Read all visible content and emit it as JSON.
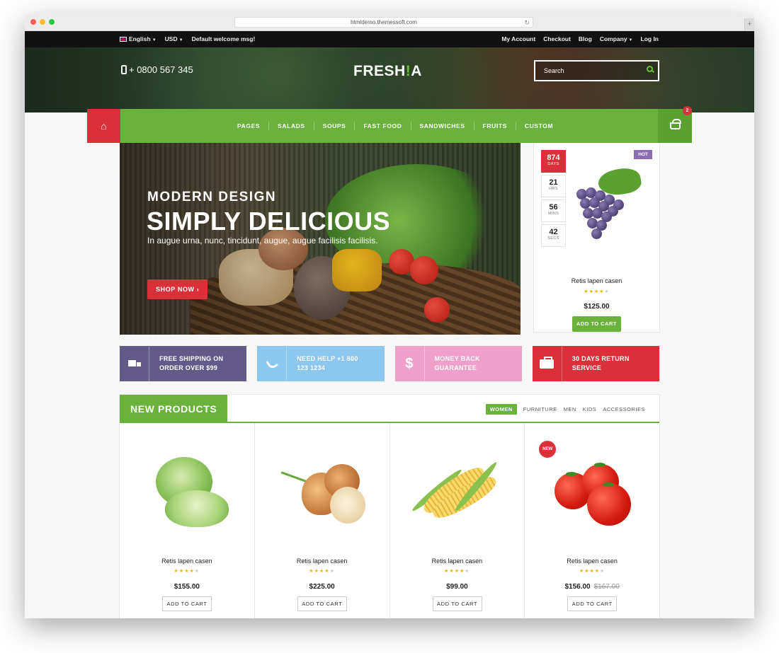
{
  "browser": {
    "url": "htmldemo.themessoft.com"
  },
  "topbar": {
    "language": "English",
    "currency": "USD",
    "welcome": "Default welcome msg!",
    "links": [
      "My Account",
      "Checkout",
      "Blog",
      "Company",
      "Log In"
    ]
  },
  "header": {
    "phone": "+ 0800 567 345",
    "logo_part1": "FRESH",
    "logo_part2": "A",
    "search_placeholder": "Search"
  },
  "nav": {
    "items": [
      "PAGES",
      "SALADS",
      "SOUPS",
      "FAST FOOD",
      "SANDWICHES",
      "FRUITS",
      "CUSTOM"
    ],
    "cart_count": "2"
  },
  "hero": {
    "subtitle": "MODERN DESIGN",
    "title": "SIMPLY DELICIOUS",
    "description": "In augue urna, nunc, tincidunt, augue, augue facilisis facilisis.",
    "cta": "SHOP NOW"
  },
  "deal": {
    "badge": "HOT",
    "countdown": [
      {
        "value": "874",
        "unit": "DAYS"
      },
      {
        "value": "21",
        "unit": "HRS"
      },
      {
        "value": "56",
        "unit": "MINS"
      },
      {
        "value": "42",
        "unit": "SECS"
      }
    ],
    "name": "Retis lapen casen",
    "rating": 4,
    "price": "$125.00",
    "cta": "ADD TO CART"
  },
  "features": [
    {
      "line1": "FREE SHIPPING ON",
      "line2": "ORDER OVER $99",
      "icon": "truck-icon",
      "color": "#635a8a"
    },
    {
      "line1": "NEED HELP +1 800",
      "line2": "123 1234",
      "icon": "phone-icon",
      "color": "#8bc7ef"
    },
    {
      "line1": "MONEY BACK",
      "line2": "GUARANTEE",
      "icon": "dollar-icon",
      "color": "#eea0c8"
    },
    {
      "line1": "30 DAYS RETURN",
      "line2": "SERVICE",
      "icon": "briefcase-icon",
      "color": "#d9303a"
    }
  ],
  "new_products": {
    "title": "NEW PRODUCTS",
    "tabs": [
      "WOMEN",
      "FURNITURE",
      "MEN",
      "KIDS",
      "ACCESSORIES"
    ],
    "active_tab": "WOMEN",
    "items": [
      {
        "name": "Retis lapen casen",
        "rating": 4,
        "price": "$155.00",
        "old_price": "",
        "cta": "ADD TO CART",
        "image": "cabbage"
      },
      {
        "name": "Retis lapen casen",
        "rating": 4,
        "price": "$225.00",
        "old_price": "",
        "cta": "ADD TO CART",
        "image": "onion"
      },
      {
        "name": "Retis lapen casen",
        "rating": 4,
        "price": "$99.00",
        "old_price": "",
        "cta": "ADD TO CART",
        "image": "corn"
      },
      {
        "name": "Retis lapen casen",
        "rating": 4,
        "price": "$156.00",
        "old_price": "$167.00",
        "cta": "ADD TO CART",
        "image": "tomato",
        "badge": "NEW"
      }
    ]
  },
  "colors": {
    "brand_green": "#69b23b",
    "brand_red": "#d9303a",
    "hot_purple": "#8a6db5"
  }
}
